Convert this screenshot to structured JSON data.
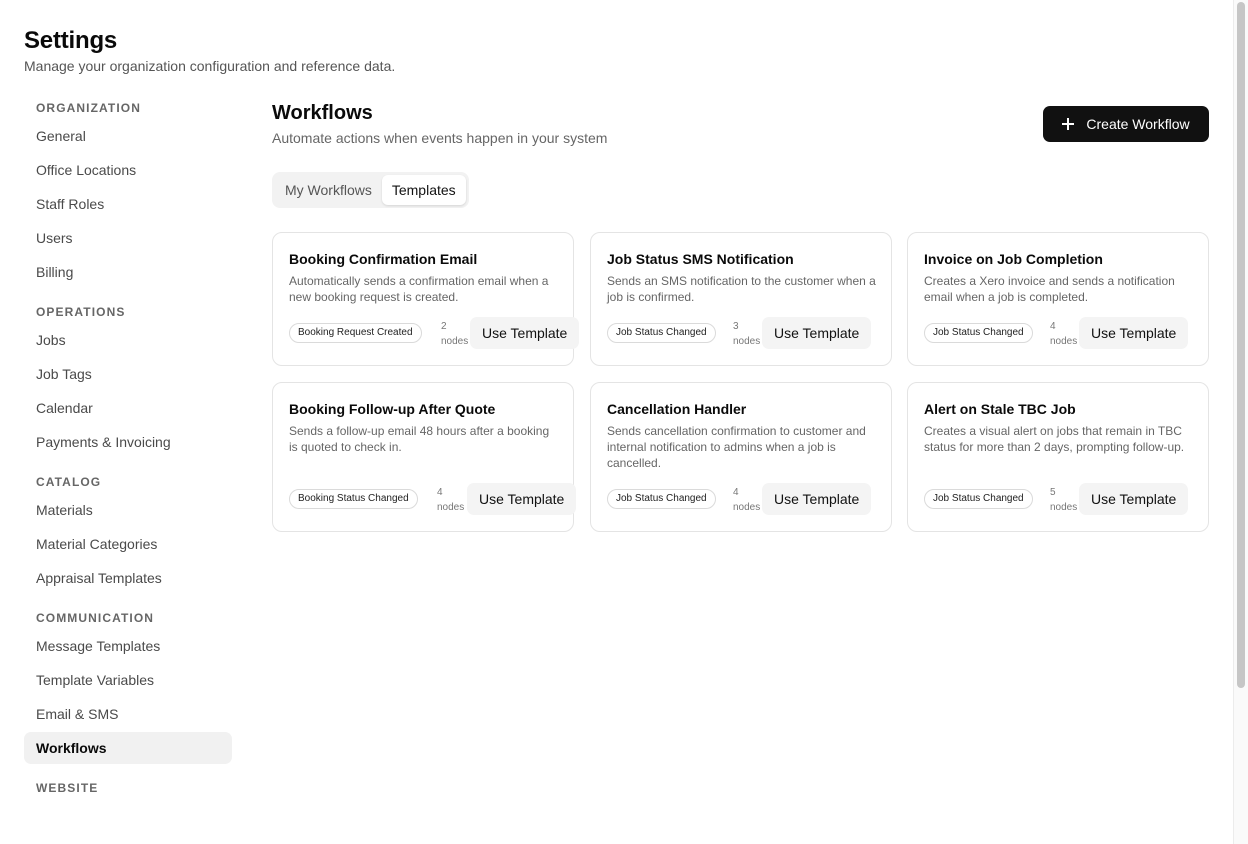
{
  "header": {
    "title": "Settings",
    "subtitle": "Manage your organization configuration and reference data."
  },
  "sidebar": {
    "sections": [
      {
        "heading": "ORGANIZATION",
        "items": [
          "General",
          "Office Locations",
          "Staff Roles",
          "Users",
          "Billing"
        ]
      },
      {
        "heading": "OPERATIONS",
        "items": [
          "Jobs",
          "Job Tags",
          "Calendar",
          "Payments & Invoicing"
        ]
      },
      {
        "heading": "CATALOG",
        "items": [
          "Materials",
          "Material Categories",
          "Appraisal Templates"
        ]
      },
      {
        "heading": "COMMUNICATION",
        "items": [
          "Message Templates",
          "Template Variables",
          "Email & SMS",
          "Workflows"
        ]
      },
      {
        "heading": "WEBSITE",
        "items": []
      }
    ],
    "active_item": "Workflows"
  },
  "main": {
    "title": "Workflows",
    "subtitle": "Automate actions when events happen in your system",
    "create_button_label": "Create Workflow",
    "tabs": [
      {
        "label": "My Workflows",
        "active": false
      },
      {
        "label": "Templates",
        "active": true
      }
    ],
    "cards": [
      {
        "title": "Booking Confirmation Email",
        "description": "Automatically sends a confirmation email when a new booking request is created.",
        "trigger": "Booking Request Created",
        "nodes": "2\nnodes",
        "button": "Use Template"
      },
      {
        "title": "Job Status SMS Notification",
        "description": "Sends an SMS notification to the customer when a job is confirmed.",
        "trigger": "Job Status Changed",
        "nodes": "3\nnodes",
        "button": "Use Template"
      },
      {
        "title": "Invoice on Job Completion",
        "description": "Creates a Xero invoice and sends a notification email when a job is completed.",
        "trigger": "Job Status Changed",
        "nodes": "4\nnodes",
        "button": "Use Template"
      },
      {
        "title": "Booking Follow-up After Quote",
        "description": "Sends a follow-up email 48 hours after a booking is quoted to check in.",
        "trigger": "Booking Status Changed",
        "nodes": "4\nnodes",
        "button": "Use Template"
      },
      {
        "title": "Cancellation Handler",
        "description": "Sends cancellation confirmation to customer and internal notification to admins when a job is cancelled.",
        "trigger": "Job Status Changed",
        "nodes": "4\nnodes",
        "button": "Use Template"
      },
      {
        "title": "Alert on Stale TBC Job",
        "description": "Creates a visual alert on jobs that remain in TBC status for more than 2 days, prompting follow-up.",
        "trigger": "Job Status Changed",
        "nodes": "5\nnodes",
        "button": "Use Template"
      }
    ]
  },
  "colors": {
    "primary_button": "#111111",
    "active_nav_bg": "#f1f1f1",
    "card_border": "#e4e4e4"
  }
}
